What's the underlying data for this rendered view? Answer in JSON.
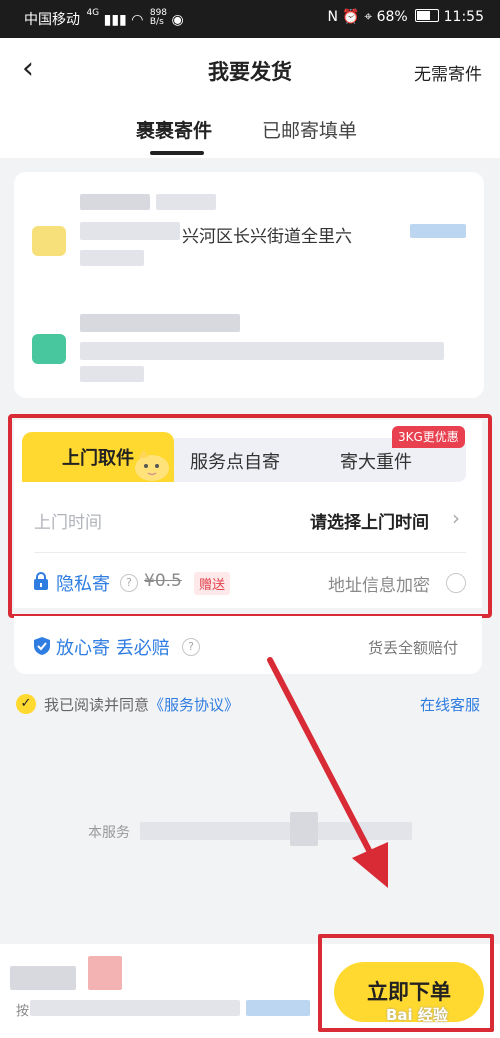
{
  "status_bar": {
    "carrier": "中国移动",
    "net": "4G",
    "speed_top": "898",
    "speed_bottom": "B/s",
    "battery": "68%",
    "time": "11:55"
  },
  "nav": {
    "back": "‹",
    "title": "我要发货",
    "right": "无需寄件"
  },
  "tabs": [
    {
      "label": "裹裹寄件",
      "active": true
    },
    {
      "label": "已邮寄填单",
      "active": false
    }
  ],
  "address": {
    "fragment": "兴河区长兴街道全里六"
  },
  "service": {
    "segments": [
      {
        "label": "上门取件",
        "active": true
      },
      {
        "label": "服务点自寄"
      },
      {
        "label": "寄大重件"
      }
    ],
    "badge": "3KG更优惠",
    "pickup_label": "上门时间",
    "pickup_value": "请选择上门时间",
    "privacy_label": "隐私寄",
    "privacy_price": "¥0.5",
    "privacy_gift": "赠送",
    "encrypt_label": "地址信息加密"
  },
  "insurance": {
    "label": "放心寄 丢必赔",
    "right": "货丢全额赔付"
  },
  "agreement": {
    "prefix": "我已阅读并同意",
    "link": "《服务协议》",
    "service": "在线客服"
  },
  "notice": {
    "text": "本服务"
  },
  "bottom": {
    "button": "立即下单",
    "prefix": "按",
    "watermark": "Bai 经验"
  },
  "colors": {
    "accent": "#ffd92f",
    "link": "#2f7de1",
    "highlight": "#d82b36"
  }
}
